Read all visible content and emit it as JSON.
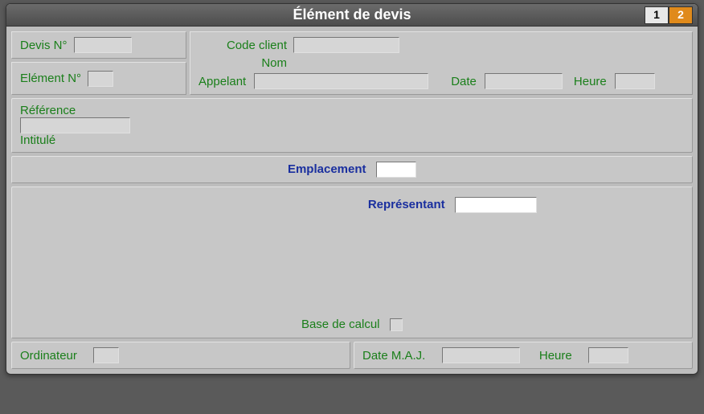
{
  "window": {
    "title": "Élément de devis"
  },
  "tabs": {
    "t1": "1",
    "t2": "2"
  },
  "labels": {
    "devis_no": "Devis N°",
    "element_no": "Elément N°",
    "code_client": "Code client",
    "nom": "Nom",
    "appelant": "Appelant",
    "date": "Date",
    "heure": "Heure",
    "reference": "Référence",
    "intitule": "Intitulé",
    "emplacement": "Emplacement",
    "representant": "Représentant",
    "base_calcul": "Base de calcul",
    "ordinateur": "Ordinateur",
    "date_maj": "Date M.A.J.",
    "heure2": "Heure"
  },
  "values": {
    "devis_no": "",
    "element_no": "",
    "code_client": "",
    "nom": "",
    "appelant": "",
    "date": "",
    "heure": "",
    "reference": "",
    "intitule": "",
    "emplacement": "",
    "representant": "",
    "ordinateur": "",
    "date_maj": "",
    "heure2": ""
  }
}
